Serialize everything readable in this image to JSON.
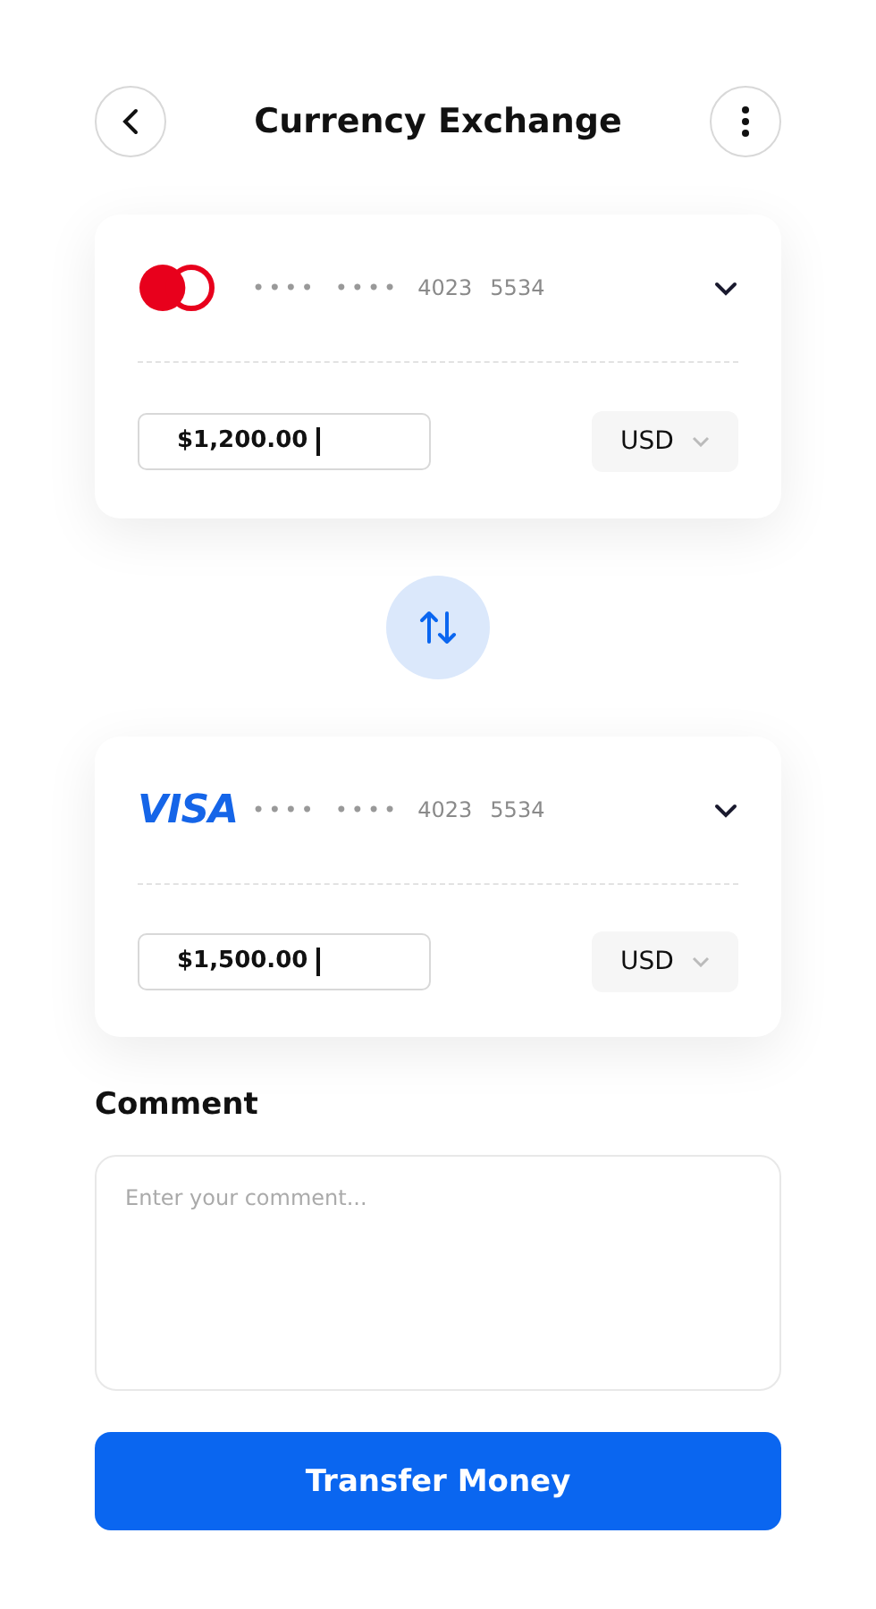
{
  "header": {
    "title": "Currency Exchange"
  },
  "cards": [
    {
      "brand": {
        "kind": "mastercard"
      },
      "number_groups": [
        "••••",
        "••••",
        "4023",
        "5534"
      ],
      "amount": {
        "value": "$1,200.00",
        "focused": true
      },
      "currency": "USD"
    },
    {
      "brand": {
        "kind": "visa",
        "label": "VISA"
      },
      "number_groups": [
        "••••",
        "••••",
        "4023",
        "5534"
      ],
      "amount": {
        "value": "$1,500.00",
        "focused": true
      },
      "currency": "USD"
    }
  ],
  "comment": {
    "label": "Comment",
    "placeholder": "Enter your comment..."
  },
  "submit_button": "Transfer Money"
}
